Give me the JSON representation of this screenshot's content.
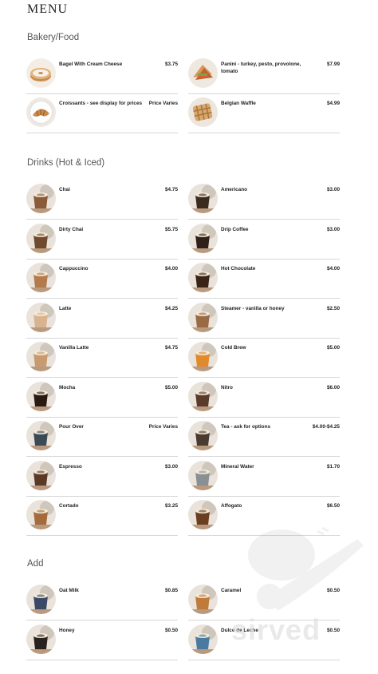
{
  "menu": {
    "title": "MENU"
  },
  "sections": [
    {
      "title": "Bakery/Food",
      "items": [
        {
          "name": "Bagel With Cream Cheese",
          "price": "$3.75",
          "icon": "bagel-photo",
          "color": "#d9a86a"
        },
        {
          "name": "Panini - turkey, pesto, provolone, tomato",
          "price": "$7.99",
          "icon": "panini-photo",
          "color": "#c9733f"
        },
        {
          "name": "Croissants - see display for prices",
          "price": "Price Varies",
          "icon": "croissant-photo",
          "color": "#c98a4a"
        },
        {
          "name": "Belgian Waffle",
          "price": "$4.99",
          "icon": "waffle-photo",
          "color": "#d8a86c"
        }
      ]
    },
    {
      "title": "Drinks (Hot & Iced)",
      "items": [
        {
          "name": "Chai",
          "price": "$4.75",
          "icon": "chai-photo",
          "color": "#8a5a3a"
        },
        {
          "name": "Americano",
          "price": "$3.00",
          "icon": "americano-photo",
          "color": "#3b2a20"
        },
        {
          "name": "Dirty Chai",
          "price": "$5.75",
          "icon": "dirty-chai-photo",
          "color": "#6e4a2e"
        },
        {
          "name": "Drip Coffee",
          "price": "$3.00",
          "icon": "drip-coffee-photo",
          "color": "#2f2119"
        },
        {
          "name": "Cappuccino",
          "price": "$4.00",
          "icon": "cappuccino-photo",
          "color": "#b37a4c"
        },
        {
          "name": "Hot Chocolate",
          "price": "$4.00",
          "icon": "hot-chocolate-photo",
          "color": "#3a2418"
        },
        {
          "name": "Latte",
          "price": "$4.25",
          "icon": "latte-photo",
          "color": "#d7b48e"
        },
        {
          "name": "Steamer - vanilla or honey",
          "price": "$2.50",
          "icon": "steamer-photo",
          "color": "#9a6a44"
        },
        {
          "name": "Vanilla Latte",
          "price": "$4.75",
          "icon": "vanilla-latte-photo",
          "color": "#c79a70"
        },
        {
          "name": "Cold Brew",
          "price": "$5.00",
          "icon": "cold-brew-photo",
          "color": "#e08a2c"
        },
        {
          "name": "Mocha",
          "price": "$5.00",
          "icon": "mocha-photo",
          "color": "#2a1a12"
        },
        {
          "name": "Nitro",
          "price": "$6.00",
          "icon": "nitro-photo",
          "color": "#5a3a2a"
        },
        {
          "name": "Pour Over",
          "price": "Price Varies",
          "icon": "pour-over-photo",
          "color": "#3c4a55"
        },
        {
          "name": "Tea - ask for options",
          "price": "$4.00-$4.25",
          "icon": "tea-photo",
          "color": "#4a3a30"
        },
        {
          "name": "Espresso",
          "price": "$3.00",
          "icon": "espresso-photo",
          "color": "#5a3a26"
        },
        {
          "name": "Mineral Water",
          "price": "$1.70",
          "icon": "mineral-water-photo",
          "color": "#8a8f94"
        },
        {
          "name": "Cortado",
          "price": "$3.25",
          "icon": "cortado-photo",
          "color": "#a66b3c"
        },
        {
          "name": "Affogato",
          "price": "$6.50",
          "icon": "affogato-photo",
          "color": "#6b3e20"
        }
      ]
    },
    {
      "title": "Add",
      "items": [
        {
          "name": "Oat Milk",
          "price": "$0.85",
          "icon": "oat-milk-photo",
          "color": "#3a4a66"
        },
        {
          "name": "Caramel",
          "price": "$0.50",
          "icon": "caramel-photo",
          "color": "#c07a3a"
        },
        {
          "name": "Honey",
          "price": "$0.50",
          "icon": "honey-photo",
          "color": "#2a221e"
        },
        {
          "name": "Dulce de Leche",
          "price": "$0.50",
          "icon": "dulce-de-leche-photo",
          "color": "#4a7aa0"
        }
      ]
    }
  ],
  "watermark": {
    "text": "sirved",
    "icon": "fork-knife-logo-icon"
  }
}
